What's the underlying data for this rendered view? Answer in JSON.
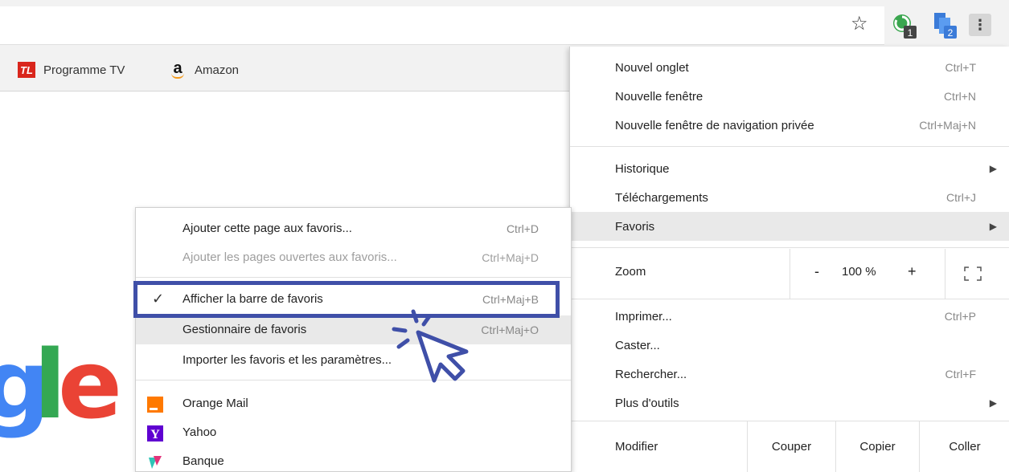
{
  "bookmarks_bar": {
    "items": [
      {
        "label": "Programme TV",
        "icon": "tele-loisirs-icon",
        "icon_text": "TL"
      },
      {
        "label": "Amazon",
        "icon": "amazon-icon",
        "icon_text": "a"
      }
    ]
  },
  "google_logo": {
    "g": "g",
    "l": "l",
    "e": "e"
  },
  "main_menu": {
    "new_tab": {
      "label": "Nouvel onglet",
      "shortcut": "Ctrl+T"
    },
    "new_window": {
      "label": "Nouvelle fenêtre",
      "shortcut": "Ctrl+N"
    },
    "incognito": {
      "label": "Nouvelle fenêtre de navigation privée",
      "shortcut": "Ctrl+Maj+N"
    },
    "history": {
      "label": "Historique"
    },
    "downloads": {
      "label": "Téléchargements",
      "shortcut": "Ctrl+J"
    },
    "bookmarks": {
      "label": "Favoris"
    },
    "zoom": {
      "label": "Zoom",
      "minus": "-",
      "value": "100 %",
      "plus": "+"
    },
    "print": {
      "label": "Imprimer...",
      "shortcut": "Ctrl+P"
    },
    "cast": {
      "label": "Caster..."
    },
    "find": {
      "label": "Rechercher...",
      "shortcut": "Ctrl+F"
    },
    "more_tools": {
      "label": "Plus d'outils"
    },
    "edit": {
      "label": "Modifier",
      "cut": "Couper",
      "copy": "Copier",
      "paste": "Coller"
    }
  },
  "bookmarks_submenu": {
    "add_page": {
      "label": "Ajouter cette page aux favoris...",
      "shortcut": "Ctrl+D"
    },
    "add_open_pages": {
      "label": "Ajouter les pages ouvertes aux favoris...",
      "shortcut": "Ctrl+Maj+D"
    },
    "show_bar": {
      "label": "Afficher la barre de favoris",
      "shortcut": "Ctrl+Maj+B",
      "checked": true
    },
    "manager": {
      "label": "Gestionnaire de favoris",
      "shortcut": "Ctrl+Maj+O"
    },
    "import": {
      "label": "Importer les favoris et les paramètres..."
    },
    "favorites": [
      {
        "label": "Orange Mail",
        "icon": "orange-icon"
      },
      {
        "label": "Yahoo",
        "icon": "yahoo-icon",
        "icon_text": "Y"
      },
      {
        "label": "Banque",
        "icon": "banque-icon"
      }
    ]
  },
  "toolbar": {
    "star_icon": "☆",
    "kebab_icon": "⋮",
    "ext1_badge": "1",
    "ext2_badge": "2"
  },
  "colors": {
    "highlight_box": "#3f4fa8",
    "google_blue": "#4285f4",
    "google_green": "#34a853",
    "google_red": "#ea4335"
  }
}
